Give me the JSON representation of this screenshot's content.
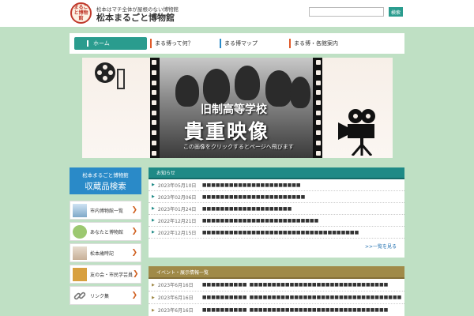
{
  "header": {
    "logo_text": "まるごと博物館",
    "tagline": "松本はマチ全体が屋根のない博物館",
    "site_name": "松本まるごと博物館",
    "search_placeholder": "",
    "search_button": "検索"
  },
  "nav": [
    {
      "label": "ホーム",
      "bar_color": "#ffffff"
    },
    {
      "label": "まる博って何？",
      "bar_color": "#e05a2a"
    },
    {
      "label": "まる博マップ",
      "bar_color": "#2a8ac8"
    },
    {
      "label": "まる博・各館案内",
      "bar_color": "#e05a2a"
    }
  ],
  "banner": {
    "title1": "旧制高等学校",
    "title2": "貴重映像",
    "subtitle": "この画像をクリックするとページへ飛びます"
  },
  "sidebar": {
    "head_small": "松本まるごと博物館",
    "head_large": "収蔵品検索",
    "items": [
      {
        "label": "市内博物館一覧",
        "icon": "museum-thumb-icon",
        "color": "#7fa8c8"
      },
      {
        "label": "あなたと博物館",
        "icon": "character-thumb-icon",
        "color": "#9cc870"
      },
      {
        "label": "松本歳時記",
        "icon": "season-thumb-icon",
        "color": "#c8b098"
      },
      {
        "label": "友の会・市民学芸員",
        "icon": "friends-thumb-icon",
        "color": "#d8a040"
      },
      {
        "label": "リンク集",
        "icon": "link-icon",
        "color": "#888888"
      }
    ]
  },
  "news": {
    "heading": "お知らせ",
    "rows": [
      {
        "date": "2023年05月10日",
        "text": "■■■■■■■■■■■■■■■■■■■■■■"
      },
      {
        "date": "2023年02月06日",
        "text": "■■■■■■■■■■■■■■■■■■■■■■■"
      },
      {
        "date": "2023年01月24日",
        "text": "■■■■■■■■■■■■■■■■■■■■"
      },
      {
        "date": "2022年12月21日",
        "text": "■■■■■■■■■■■■■■■■■■■■■■■■■■"
      },
      {
        "date": "2022年12月15日",
        "text": "■■■■■■■■■■■■■■■■■■■■■■■■■■■■■■■■■■■"
      }
    ],
    "more": ">>一覧を見る"
  },
  "events": {
    "heading": "イベント・展示情報一覧",
    "rows": [
      {
        "date": "2023年6月16日",
        "category": "■■■■■■■■■■",
        "text": "■■■■■■■■■■■■■■■■■■■■■■■■■■■■■■■"
      },
      {
        "date": "2023年6月16日",
        "category": "■■■■■■■■■■",
        "text": "■■■■■■■■■■■■■■■■■■■■■■■■■■■■■■■■■■"
      },
      {
        "date": "2023年6月16日",
        "category": "■■■■■■■■■■",
        "text": "■■■■■■■■■■■■■■■■■■■■■■■■■■■■■■■"
      }
    ]
  }
}
